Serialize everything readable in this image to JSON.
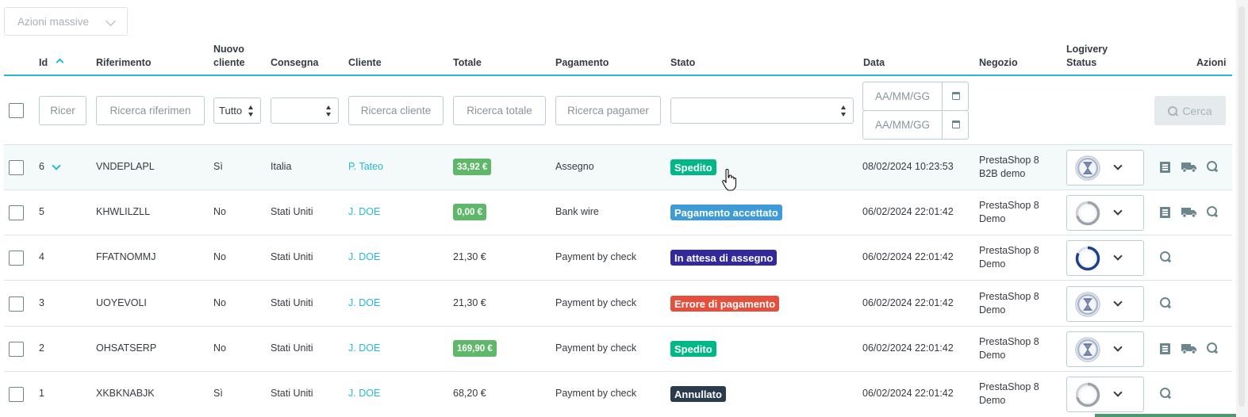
{
  "bulk_actions": {
    "label": "Azioni massive"
  },
  "headers": {
    "id": "Id",
    "reference": "Riferimento",
    "new_client_1": "Nuovo",
    "new_client_2": "cliente",
    "delivery": "Consegna",
    "client": "Cliente",
    "total": "Totale",
    "payment": "Pagamento",
    "status": "Stato",
    "date": "Data",
    "store": "Negozio",
    "logivery_1": "Logivery",
    "logivery_2": "Status",
    "actions": "Azioni"
  },
  "filters": {
    "id": "Ricer",
    "reference": "Ricerca riferimen",
    "new_client": "Tutto",
    "client": "Ricerca cliente",
    "total": "Ricerca totale",
    "payment": "Ricerca pagamer",
    "date_from": "AA/MM/GG",
    "date_to": "AA/MM/GG",
    "search_button": "Cerca"
  },
  "orders": [
    {
      "id": "6",
      "reference": "VNDEPLAPL",
      "new_client": "Sì",
      "delivery": "Italia",
      "client": "P. Tateo",
      "total": "33,92 €",
      "total_highlight": true,
      "payment": "Assegno",
      "status": "Spedito",
      "status_color": "#00b887",
      "date": "08/02/2024 10:23:53",
      "store_1": "PrestaShop 8",
      "store_2": "B2B demo",
      "logivery_icon": "hourglass",
      "actions": [
        "list-icon",
        "truck-icon",
        "view-icon"
      ]
    },
    {
      "id": "5",
      "reference": "KHWLILZLL",
      "new_client": "No",
      "delivery": "Stati Uniti",
      "client": "J. DOE",
      "total": "0,00 €",
      "total_highlight": true,
      "payment": "Bank wire",
      "status": "Pagamento accettato",
      "status_color": "#3e9bd5",
      "date": "06/02/2024 22:01:42",
      "store_1": "PrestaShop 8",
      "store_2": "Demo",
      "logivery_icon": "ring-gray",
      "actions": [
        "list-icon",
        "truck-icon",
        "view-icon"
      ]
    },
    {
      "id": "4",
      "reference": "FFATNOMMJ",
      "new_client": "No",
      "delivery": "Stati Uniti",
      "client": "J. DOE",
      "total": "21,30 €",
      "total_highlight": false,
      "payment": "Payment by check",
      "status": "In attesa di assegno",
      "status_color": "#322a9c",
      "date": "06/02/2024 22:01:42",
      "store_1": "PrestaShop 8",
      "store_2": "Demo",
      "logivery_icon": "ring-blue",
      "actions": [
        "view-icon"
      ]
    },
    {
      "id": "3",
      "reference": "UOYEVOLI",
      "new_client": "No",
      "delivery": "Stati Uniti",
      "client": "J. DOE",
      "total": "21,30 €",
      "total_highlight": false,
      "payment": "Payment by check",
      "status": "Errore di pagamento",
      "status_color": "#e4503d",
      "date": "06/02/2024 22:01:42",
      "store_1": "PrestaShop 8",
      "store_2": "Demo",
      "logivery_icon": "hourglass",
      "actions": [
        "view-icon"
      ]
    },
    {
      "id": "2",
      "reference": "OHSATSERP",
      "new_client": "No",
      "delivery": "Stati Uniti",
      "client": "J. DOE",
      "total": "169,90 €",
      "total_highlight": true,
      "payment": "Payment by check",
      "status": "Spedito",
      "status_color": "#00b887",
      "date": "06/02/2024 22:01:42",
      "store_1": "PrestaShop 8",
      "store_2": "Demo",
      "logivery_icon": "hourglass",
      "actions": [
        "list-icon",
        "truck-icon",
        "view-icon"
      ]
    },
    {
      "id": "1",
      "reference": "XKBKNABJK",
      "new_client": "Sì",
      "delivery": "Stati Uniti",
      "client": "J. DOE",
      "total": "68,20 €",
      "total_highlight": false,
      "payment": "Payment by check",
      "status": "Annullato",
      "status_color": "#2a3b4d",
      "date": "06/02/2024 22:01:42",
      "store_1": "PrestaShop 8",
      "store_2": "Demo",
      "logivery_icon": "ring-gray",
      "actions": [
        "view-icon"
      ]
    }
  ],
  "colors": {
    "accent": "#25b9d7",
    "total_pill": "#5fb76a",
    "text": "#363a41"
  }
}
